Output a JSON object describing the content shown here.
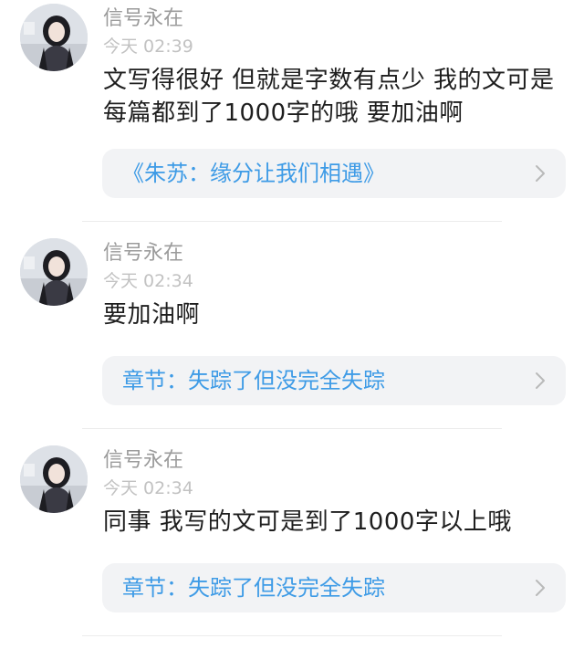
{
  "comments": [
    {
      "username": "信号永在",
      "time": "今天 02:39",
      "text": "文写得很好 但就是字数有点少 我的文可是每篇都到了1000字的哦 要加油啊",
      "reference": "《朱苏：缘分让我们相遇》"
    },
    {
      "username": "信号永在",
      "time": "今天 02:34",
      "text": "要加油啊",
      "reference": "章节：失踪了但没完全失踪"
    },
    {
      "username": "信号永在",
      "time": "今天 02:34",
      "text": "同事 我写的文可是到了1000字以上哦",
      "reference": "章节：失踪了但没完全失踪"
    }
  ],
  "colors": {
    "link": "#3e9be6",
    "card_bg": "#f2f3f5",
    "username": "#9b9b9b",
    "time": "#c2c2c2"
  },
  "icons": {
    "avatar": "avatar",
    "chevron": "chevron-right-icon"
  }
}
